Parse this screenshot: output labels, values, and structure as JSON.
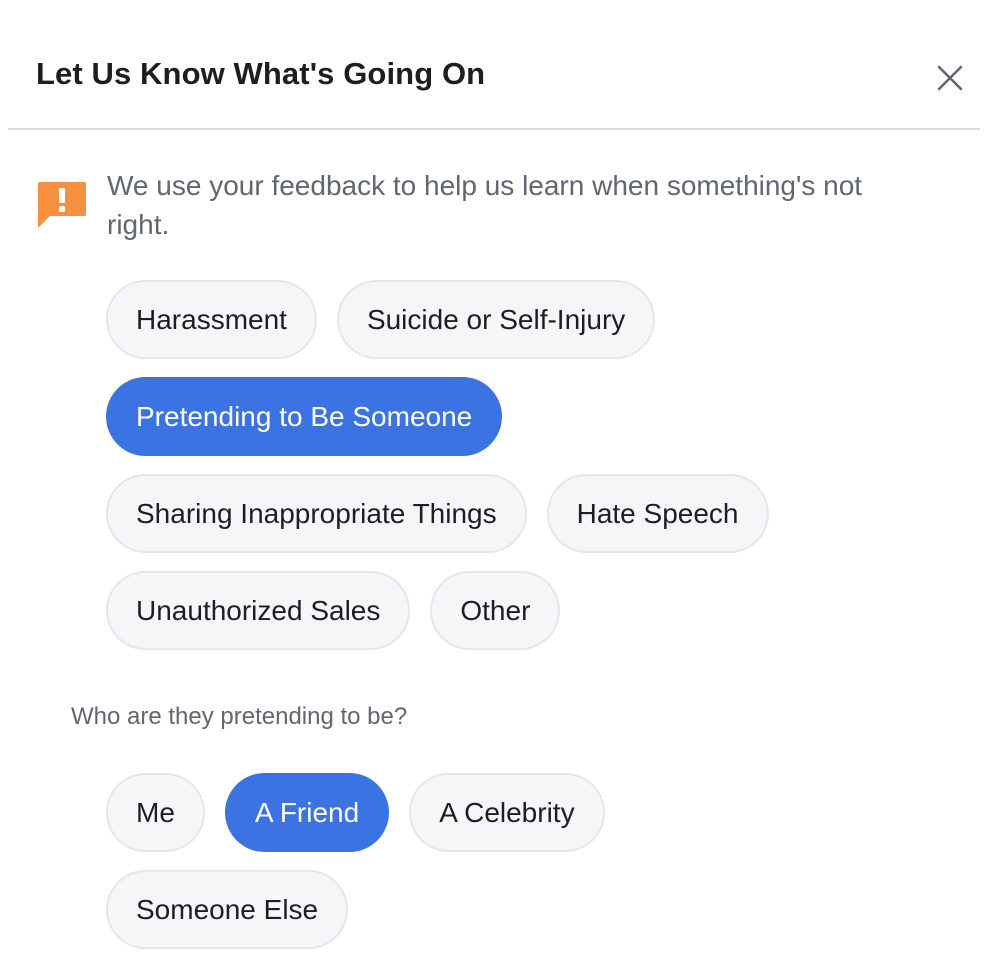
{
  "dialog": {
    "title": "Let Us Know What's Going On",
    "close_icon": "close-icon"
  },
  "notice": {
    "icon": "feedback-alert-icon",
    "icon_color": "#f5913e",
    "text": "We use your feedback to help us learn when something's not right."
  },
  "categories": [
    {
      "label": "Harassment",
      "selected": false
    },
    {
      "label": "Suicide or Self-Injury",
      "selected": false
    },
    {
      "label": "Pretending to Be Someone",
      "selected": true
    },
    {
      "label": "Sharing Inappropriate Things",
      "selected": false
    },
    {
      "label": "Hate Speech",
      "selected": false
    },
    {
      "label": "Unauthorized Sales",
      "selected": false
    },
    {
      "label": "Other",
      "selected": false
    }
  ],
  "followup": {
    "question": "Who are they pretending to be?",
    "options": [
      {
        "label": "Me",
        "selected": false
      },
      {
        "label": "A Friend",
        "selected": true
      },
      {
        "label": "A Celebrity",
        "selected": false
      },
      {
        "label": "Someone Else",
        "selected": false
      }
    ]
  },
  "colors": {
    "selected_chip": "#3b73e3",
    "chip_background": "#f5f6f7",
    "muted_text": "#606770"
  }
}
